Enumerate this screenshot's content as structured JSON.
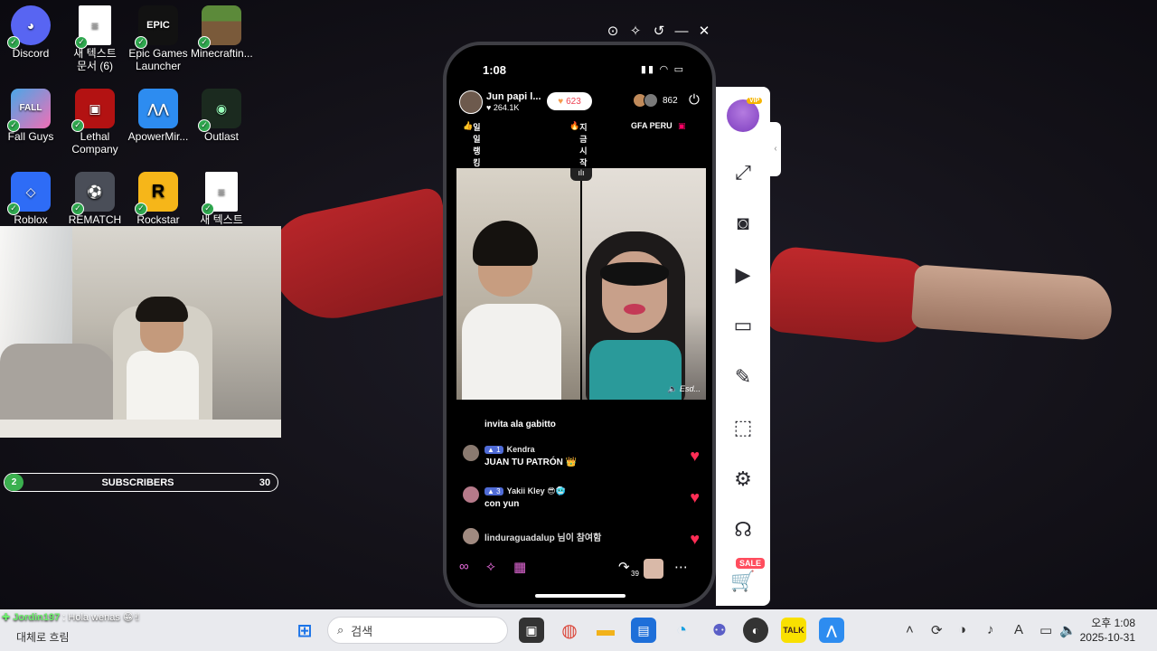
{
  "desktop": {
    "icons": [
      {
        "label": "Discord",
        "icon": "discord-icon",
        "color": "#5865f2"
      },
      {
        "label": "새 텍스트\n문서 (6)",
        "icon": "text-file-icon",
        "color": "#ffffff"
      },
      {
        "label": "Epic Games\nLauncher",
        "icon": "epic-games-icon",
        "color": "#121212"
      },
      {
        "label": "Minecraftin...",
        "icon": "minecraft-icon",
        "color": "#5c8a3a"
      },
      {
        "label": "Fall Guys",
        "icon": "fall-guys-icon",
        "color": "#4aa7e8"
      },
      {
        "label": "Lethal\nCompany",
        "icon": "lethal-company-icon",
        "color": "#b31212"
      },
      {
        "label": "ApowerMir...",
        "icon": "apowermirror-icon",
        "color": "#2d8cf0"
      },
      {
        "label": "Outlast",
        "icon": "outlast-icon",
        "color": "#1b2a1f"
      },
      {
        "label": "Roblox",
        "icon": "roblox-icon",
        "color": "#2e6cf6"
      },
      {
        "label": "REMATCH",
        "icon": "rematch-icon",
        "color": "#4a4e58"
      },
      {
        "label": "Rockstar",
        "icon": "rockstar-icon",
        "color": "#f6b619"
      },
      {
        "label": "새 텍스트",
        "icon": "text-file-icon",
        "color": "#ffffff"
      }
    ]
  },
  "subscribers": {
    "current": "2",
    "label": "SUBSCRIBERS",
    "goal": "30",
    "progress": 0.07
  },
  "mirror_window": {
    "controls": [
      "record-icon",
      "pin-icon",
      "rotate-icon",
      "minimize-icon",
      "close-icon"
    ]
  },
  "phone": {
    "status_time": "1:08",
    "host_name": "Jun papi l...",
    "host_likes": "264.1K",
    "like_count": "623",
    "viewer_count": "862",
    "tags": {
      "ranking": "일일 랭킹",
      "start": "지금 시작",
      "agency": "GFA PERU"
    },
    "guest_label": "Esd...",
    "chat": {
      "invite_line": "invita ala gabitto",
      "messages": [
        {
          "level": "1",
          "user": "Kendra",
          "text": "JUAN TU PATRÓN 👑"
        },
        {
          "level": "3",
          "user": "Yakii Kley 😎🥶",
          "text": "con yun"
        },
        {
          "join": "linduraguadalup 님이 참여함"
        }
      ]
    },
    "gift_count": "39"
  },
  "toolbar": {
    "vip_label": "VIP",
    "tools": [
      "fullscreen-icon",
      "screenshot-icon",
      "record-video-icon",
      "cast-screen-icon",
      "brush-icon",
      "select-area-icon",
      "settings-icon",
      "support-headset-icon",
      "cart-icon"
    ],
    "sale_label": "SALE"
  },
  "stream_chat": {
    "name": "Jordin197",
    "text": "Hola wenas 😁✌"
  },
  "taskbar": {
    "weather_text": "대체로 흐림",
    "search_placeholder": "검색",
    "clock_period_time": "오후 1:08",
    "clock_date": "2025-10-31"
  }
}
